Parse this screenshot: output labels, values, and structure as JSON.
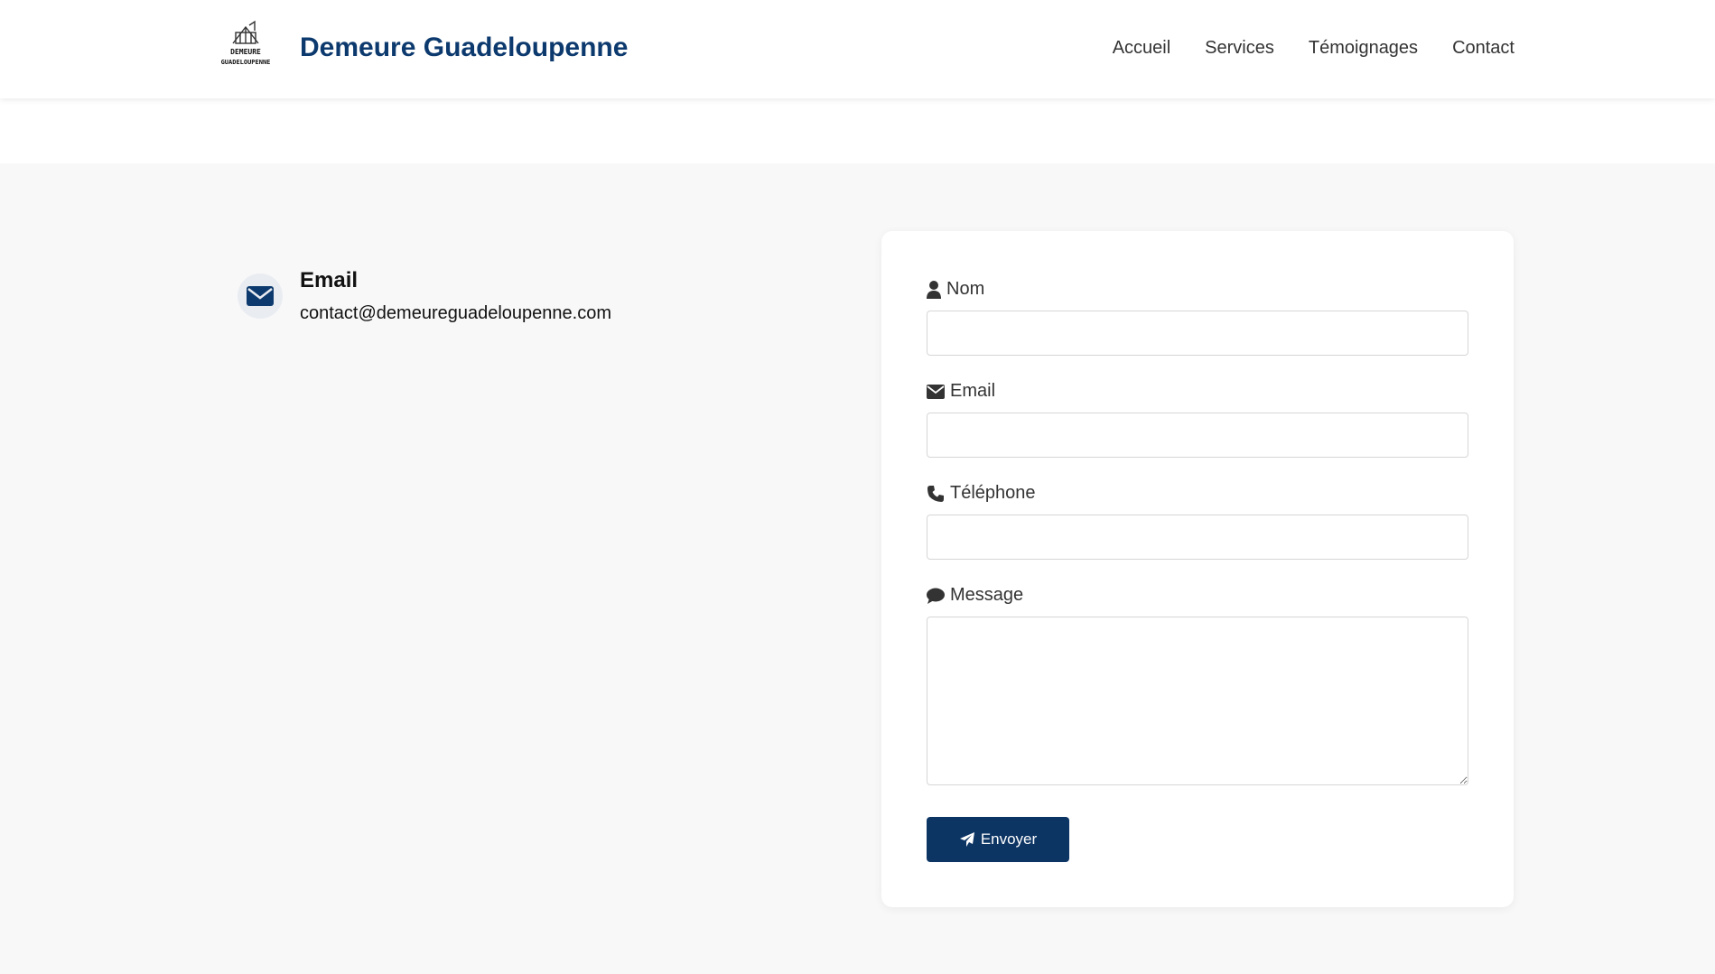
{
  "header": {
    "brand": "Demeure Guadeloupenne",
    "logo_lines": [
      "DEMEURE",
      "GUADELOUPENNE"
    ],
    "nav": [
      "Accueil",
      "Services",
      "Témoignages",
      "Contact"
    ]
  },
  "contact_info": {
    "icon": "envelope-icon",
    "title": "Email",
    "value": "contact@demeureguadeloupenne.com"
  },
  "form": {
    "fields": [
      {
        "label": "Nom",
        "icon": "user-icon",
        "value": ""
      },
      {
        "label": "Email",
        "icon": "envelope-icon",
        "value": ""
      },
      {
        "label": "Téléphone",
        "icon": "phone-icon",
        "value": ""
      },
      {
        "label": "Message",
        "icon": "comment-icon",
        "value": ""
      }
    ],
    "submit_label": "Envoyer",
    "submit_icon": "paper-plane-icon"
  },
  "colors": {
    "brand": "#0d3a6e",
    "button": "#0d3564",
    "band_background": "#f8f8f8",
    "icon_circle": "#e9ecf1"
  }
}
